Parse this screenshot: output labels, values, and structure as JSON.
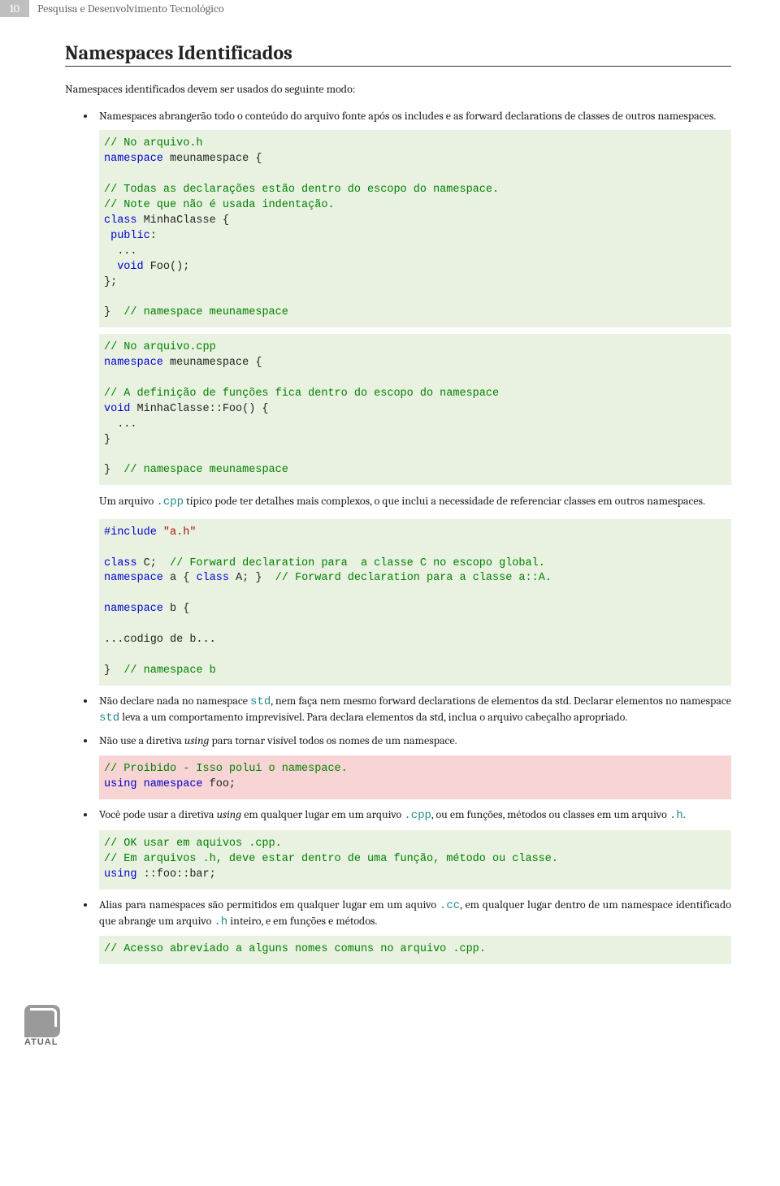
{
  "header": {
    "page_number": "10",
    "running_head": "Pesquisa e Desenvolvimento Tecnológico"
  },
  "section_title": "Namespaces Identificados",
  "intro": "Namespaces identificados devem ser usados do seguinte modo:",
  "bullet1": "Namespaces abrangerão todo o conteúdo do arquivo fonte após os includes e as forward declarations de classes de outros namespaces.",
  "code1": {
    "l1a": "// No arquivo.h",
    "l1b_kw": "namespace",
    "l1b_rest": " meunamespace {",
    "l2": "// Todas as declarações estão dentro do escopo do namespace.",
    "l3": "// Note que não é usada indentação.",
    "l4_kw": "class",
    "l4_rest": " MinhaClasse {",
    "l5_kw": " public",
    "l5_rest": ":",
    "l6": "  ...",
    "l7_kw": "  void",
    "l7_rest": " Foo();",
    "l8": "};",
    "l9a": "}  ",
    "l9b": "// namespace meunamespace"
  },
  "code2": {
    "l1": "// No arquivo.cpp",
    "l2_kw": "namespace",
    "l2_rest": " meunamespace {",
    "l3": "// A definição de funções fica dentro do escopo do namespace",
    "l4_kw": "void",
    "l4_rest": " MinhaClasse::Foo() {",
    "l5": "  ...",
    "l6": "}",
    "l7a": "}  ",
    "l7b": "// namespace meunamespace"
  },
  "para_after_code2_a": "Um arquivo ",
  "para_after_code2_mono": ".cpp",
  "para_after_code2_b": " típico pode ter detalhes mais complexos, o que inclui a necessidade de referenciar classes em outros namespaces.",
  "code3": {
    "l1_kw": "#include",
    "l1_str": " \"a.h\"",
    "l2_kw": "class",
    "l2_rest": " C;  ",
    "l2_cmt": "// Forward declaration para  a classe C no escopo global.",
    "l3_kw1": "namespace",
    "l3_rest1": " a { ",
    "l3_kw2": "class",
    "l3_rest2": " A; }  ",
    "l3_cmt": "// Forward declaration para a classe a::A.",
    "l4_kw": "namespace",
    "l4_rest": " b {",
    "l5": "...codigo de b...",
    "l6a": "}  ",
    "l6b": "// namespace b"
  },
  "bullet2_a": "Não declare nada no namespace ",
  "bullet2_std1": "std",
  "bullet2_b": ", nem faça nem mesmo forward declarations de elementos da std. Declarar elementos no namespace ",
  "bullet2_std2": "std",
  "bullet2_c": " leva a um comportamento imprevisível. Para declara elementos da std, inclua o arquivo cabeçalho apropriado.",
  "bullet3_a": "Não use a diretiva ",
  "bullet3_using": "using",
  "bullet3_b": " para tornar visível todos os nomes de um namespace.",
  "code4": {
    "l1": "// Proibido - Isso polui o namespace.",
    "l2_kw": "using namespace",
    "l2_rest": " foo;"
  },
  "bullet4_a": "Você pode usar a diretiva ",
  "bullet4_using": "using",
  "bullet4_b": " em qualquer lugar em um arquivo ",
  "bullet4_cpp": ".cpp",
  "bullet4_c": ", ou em funções, métodos ou classes em um arquivo ",
  "bullet4_h": ".h",
  "bullet4_d": ".",
  "code5": {
    "l1": "// OK usar em aquivos .cpp.",
    "l2": "// Em arquivos .h, deve estar dentro de uma função, método ou classe.",
    "l3_kw": "using",
    "l3_rest": " ::foo::bar;"
  },
  "bullet5_a": "Alias para namespaces são permitidos em qualquer lugar em um aquivo ",
  "bullet5_cc": ".cc",
  "bullet5_b": ", em qualquer lugar dentro de um namespace identificado que abrange um arquivo ",
  "bullet5_h": ".h",
  "bullet5_c": " inteiro, e em funções e métodos.",
  "code6": {
    "l1": "// Acesso abreviado a alguns nomes comuns no arquivo .cpp."
  },
  "footer_logo_text": "ATUAL"
}
